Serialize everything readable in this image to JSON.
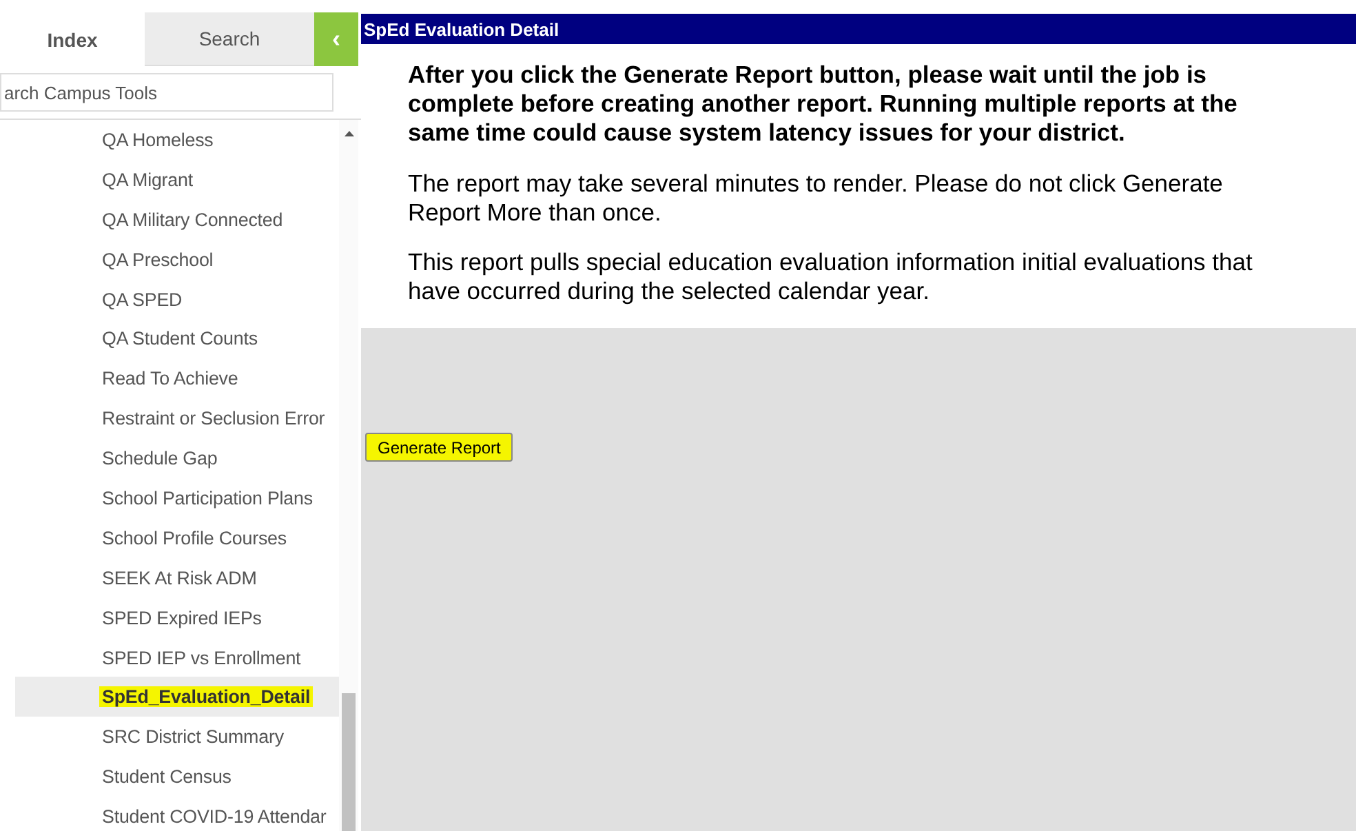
{
  "sidebar": {
    "tabs": [
      {
        "label": "Index",
        "selected": true
      },
      {
        "label": "Search",
        "selected": false
      }
    ],
    "collapse_button": {
      "label": "‹"
    },
    "search": {
      "placeholder": "arch Campus Tools"
    },
    "items": [
      {
        "label": "QA Homeless",
        "selected": false
      },
      {
        "label": "QA Migrant",
        "selected": false
      },
      {
        "label": "QA Military Connected",
        "selected": false
      },
      {
        "label": "QA Preschool",
        "selected": false
      },
      {
        "label": "QA SPED",
        "selected": false
      },
      {
        "label": "QA Student Counts",
        "selected": false
      },
      {
        "label": "Read To Achieve",
        "selected": false
      },
      {
        "label": "Restraint or Seclusion Error",
        "selected": false
      },
      {
        "label": "Schedule Gap",
        "selected": false
      },
      {
        "label": "School Participation Plans",
        "selected": false
      },
      {
        "label": "School Profile Courses",
        "selected": false
      },
      {
        "label": "SEEK At Risk ADM",
        "selected": false
      },
      {
        "label": "SPED Expired IEPs",
        "selected": false
      },
      {
        "label": "SPED IEP vs Enrollment",
        "selected": false
      },
      {
        "label": "SpEd_Evaluation_Detail",
        "selected": true
      },
      {
        "label": "SRC District Summary",
        "selected": false
      },
      {
        "label": "Student Census",
        "selected": false
      },
      {
        "label": "Student COVID-19 Attendar",
        "selected": false
      }
    ]
  },
  "main": {
    "title": "SpEd Evaluation Detail",
    "warning": "After you click the Generate Report button, please wait until the job is complete before creating another report. Running multiple reports at the same time could cause system latency issues for your district.",
    "paragraphs": [
      "The report may take several minutes to render. Please do not click Generate Report More than once.",
      "This report pulls special education evaluation information initial evaluations that have occurred during the selected calendar year."
    ],
    "button": {
      "label": "Generate Report",
      "highlighted": true
    }
  }
}
